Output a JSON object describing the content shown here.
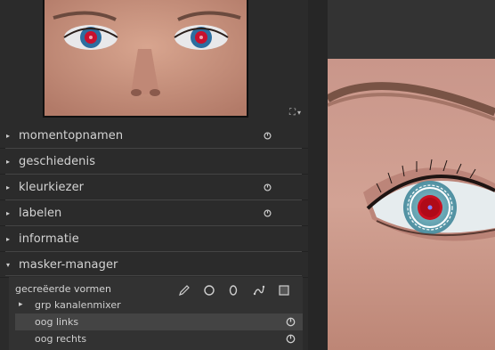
{
  "navigation": {
    "zoom_icon": "fit-zoom-icon",
    "dropdown_arrow": "▾"
  },
  "modules": [
    {
      "label": "momentopnamen",
      "expanded": false,
      "has_power": true
    },
    {
      "label": "geschiedenis",
      "expanded": false,
      "has_power": false
    },
    {
      "label": "kleurkiezer",
      "expanded": false,
      "has_power": true
    },
    {
      "label": "labelen",
      "expanded": false,
      "has_power": true
    },
    {
      "label": "informatie",
      "expanded": false,
      "has_power": false
    },
    {
      "label": "masker-manager",
      "expanded": true,
      "has_power": false
    }
  ],
  "icons": {
    "collapsed": "▸",
    "expanded": "▾",
    "group": "▸"
  },
  "mask_manager": {
    "header_label": "gecreëerde vormen",
    "tools": [
      "pen-icon",
      "circle-icon",
      "ellipse-icon",
      "path-icon",
      "square-icon"
    ],
    "rows": [
      {
        "label": "grp kanalenmixer",
        "is_group": true,
        "selected": false,
        "has_power": false
      },
      {
        "label": "oog links",
        "is_group": false,
        "selected": true,
        "has_power": true
      },
      {
        "label": "oog rechts",
        "is_group": false,
        "selected": false,
        "has_power": true
      }
    ]
  },
  "colors": {
    "panel_bg": "#2b2b2b",
    "selected_row": "#444444",
    "eye_red": "#c81020"
  }
}
